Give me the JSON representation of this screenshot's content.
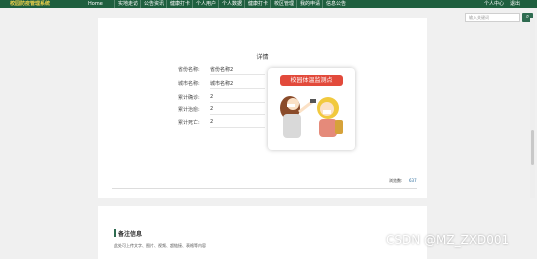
{
  "nav": {
    "brand": "校园防疫管理系统",
    "items": [
      "Home",
      "实地走访",
      "公告资讯",
      "健康打卡",
      "个人用户",
      "个人数据",
      "健康打卡",
      "校区管理",
      "我的申请",
      "信息公告"
    ],
    "user_center": "个人中心",
    "logout": "退出"
  },
  "search": {
    "placeholder": "输入关键词"
  },
  "detail": {
    "title": "详情",
    "fields": [
      {
        "label": "省份名称:",
        "value": "省份名称2"
      },
      {
        "label": "城市名称:",
        "value": "城市名称2"
      },
      {
        "label": "累计确诊:",
        "value": "2"
      },
      {
        "label": "累计治愈:",
        "value": "2"
      },
      {
        "label": "累计死亡:",
        "value": "2"
      }
    ],
    "image_banner": "校园体温监测点",
    "views_label": "浏览数:",
    "views_value": "637"
  },
  "remark": {
    "title": "备注信息",
    "text": "此处可上传文字、图片、视频、超链接、表格等内容"
  },
  "watermark": "CSDN @MZ_ZXD001",
  "colors": {
    "nav_bg": "#1f5f3f",
    "accent": "#2e6b50",
    "banner": "#e24a3b",
    "brand_text": "#f1d34b"
  }
}
